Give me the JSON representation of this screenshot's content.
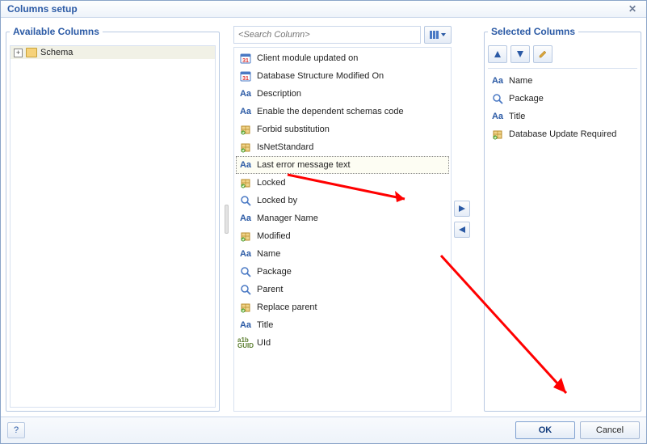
{
  "title": "Columns setup",
  "availableTitle": "Available Columns",
  "selectedTitle": "Selected Columns",
  "tree": {
    "root": "Schema"
  },
  "search": {
    "placeholder": "<Search Column>"
  },
  "middleColumns": [
    {
      "icon": "calendar",
      "label": "Client module updated on"
    },
    {
      "icon": "calendar",
      "label": "Database Structure Modified On"
    },
    {
      "icon": "aa",
      "label": "Description"
    },
    {
      "icon": "aa",
      "label": "Enable the dependent schemas code"
    },
    {
      "icon": "pkg",
      "label": "Forbid substitution"
    },
    {
      "icon": "pkg",
      "label": "IsNetStandard"
    },
    {
      "icon": "aa",
      "label": "Last error message text",
      "selected": true
    },
    {
      "icon": "pkg",
      "label": "Locked"
    },
    {
      "icon": "mag",
      "label": "Locked by"
    },
    {
      "icon": "aa",
      "label": "Manager Name"
    },
    {
      "icon": "pkg",
      "label": "Modified"
    },
    {
      "icon": "aa",
      "label": "Name"
    },
    {
      "icon": "mag",
      "label": "Package"
    },
    {
      "icon": "mag",
      "label": "Parent"
    },
    {
      "icon": "pkg",
      "label": "Replace parent"
    },
    {
      "icon": "aa",
      "label": "Title"
    },
    {
      "icon": "guid",
      "label": "UId"
    }
  ],
  "selectedColumns": [
    {
      "icon": "aa",
      "label": "Name"
    },
    {
      "icon": "mag",
      "label": "Package"
    },
    {
      "icon": "aa",
      "label": "Title"
    },
    {
      "icon": "pkg",
      "label": "Database Update Required"
    }
  ],
  "buttons": {
    "ok": "OK",
    "cancel": "Cancel"
  }
}
